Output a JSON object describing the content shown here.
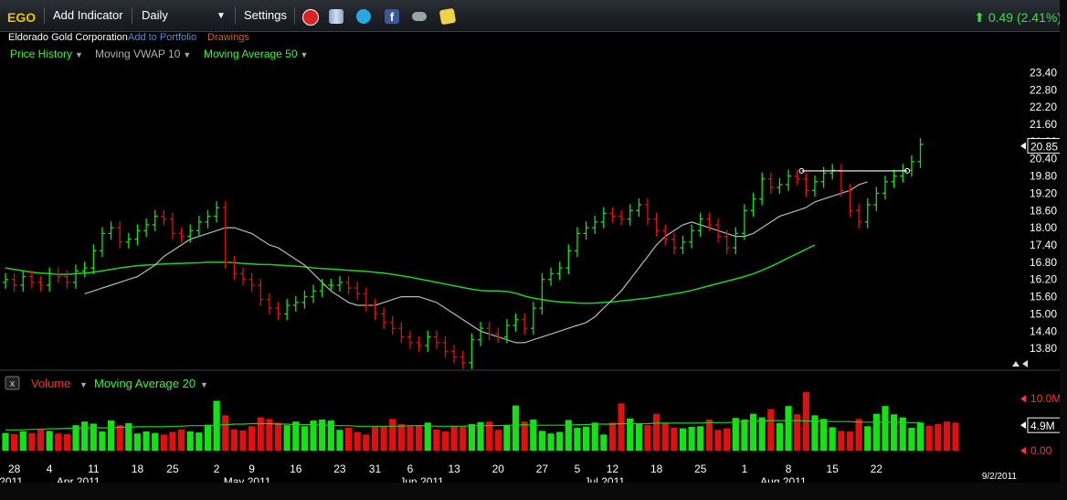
{
  "toolbar": {
    "ticker": "EGO",
    "add_indicator": "Add Indicator",
    "interval": "Daily",
    "settings": "Settings",
    "change": "0.49 (2.41%)",
    "icons": [
      "alarm-clock-icon",
      "books-icon",
      "twitter-icon",
      "facebook-icon",
      "binoculars-icon",
      "note-icon"
    ]
  },
  "header": {
    "company": "Eldorado Gold Corporation",
    "add_to_portfolio": "Add to Portfolio",
    "drawings": "Drawings"
  },
  "price_legend": {
    "price_history": "Price History",
    "vwap": "Moving VWAP 10",
    "ma": "Moving Average 50"
  },
  "volume_legend": {
    "volume": "Volume",
    "ma": "Moving Average 20"
  },
  "colors": {
    "up": "#16e016",
    "down": "#e01010",
    "ma": "#1fd21f",
    "vwap": "#b8b8b8",
    "ticker": "#f2c200"
  },
  "chart_data": {
    "type": "ohlc",
    "price_axis": {
      "ticks": [
        "23.40",
        "22.80",
        "22.20",
        "21.60",
        "21.00",
        "20.40",
        "19.80",
        "19.20",
        "18.60",
        "18.00",
        "17.40",
        "16.80",
        "16.20",
        "15.60",
        "15.00",
        "14.40",
        "13.80"
      ],
      "last_price": "20.85",
      "ylim": [
        13.2,
        23.7
      ]
    },
    "volume_axis": {
      "ticks": [
        "10.0M",
        "4.9M",
        "0.00"
      ]
    },
    "x_labels": [
      {
        "i": 1,
        "t": "28"
      },
      {
        "i": 5,
        "t": "4"
      },
      {
        "i": 10,
        "t": "11"
      },
      {
        "i": 15,
        "t": "18"
      },
      {
        "i": 19,
        "t": "25"
      },
      {
        "i": 24,
        "t": "2"
      },
      {
        "i": 28,
        "t": "9"
      },
      {
        "i": 33,
        "t": "16"
      },
      {
        "i": 38,
        "t": "23"
      },
      {
        "i": 42,
        "t": "31"
      },
      {
        "i": 46,
        "t": "6"
      },
      {
        "i": 51,
        "t": "13"
      },
      {
        "i": 56,
        "t": "20"
      },
      {
        "i": 61,
        "t": "27"
      },
      {
        "i": 65,
        "t": "5"
      },
      {
        "i": 69,
        "t": "12"
      },
      {
        "i": 74,
        "t": "18"
      },
      {
        "i": 79,
        "t": "25"
      },
      {
        "i": 84,
        "t": "1"
      },
      {
        "i": 89,
        "t": "8"
      },
      {
        "i": 94,
        "t": "15"
      },
      {
        "i": 99,
        "t": "22"
      }
    ],
    "month_labels": [
      "2011",
      "Apr 2011",
      "May 2011",
      "Jun 2011",
      "Jul 2011",
      "Aug 2011"
    ],
    "month_positions": [
      -0.5,
      6,
      25,
      45,
      66,
      86
    ],
    "end_date": "9/2/2011",
    "closes": [
      16.2,
      16.0,
      16.3,
      16.1,
      16.0,
      16.4,
      16.3,
      16.1,
      16.5,
      16.6,
      17.2,
      17.8,
      18.0,
      17.5,
      17.6,
      17.9,
      18.1,
      18.4,
      18.3,
      17.8,
      17.7,
      17.9,
      18.2,
      18.4,
      18.7,
      16.8,
      16.4,
      16.2,
      16.0,
      15.5,
      15.2,
      15.0,
      15.3,
      15.4,
      15.6,
      15.8,
      16.0,
      16.0,
      16.1,
      15.9,
      15.7,
      15.3,
      15.0,
      14.7,
      14.5,
      14.2,
      14.0,
      13.9,
      14.2,
      14.0,
      13.7,
      13.5,
      13.3,
      14.1,
      14.5,
      14.3,
      14.2,
      14.6,
      14.8,
      14.5,
      15.2,
      16.2,
      16.4,
      16.6,
      17.2,
      17.8,
      18.0,
      18.2,
      18.5,
      18.4,
      18.3,
      18.6,
      18.8,
      18.3,
      17.9,
      17.6,
      17.3,
      17.5,
      17.9,
      18.3,
      18.1,
      17.7,
      17.3,
      17.8,
      18.6,
      19.0,
      19.7,
      19.4,
      19.5,
      19.8,
      19.7,
      19.3,
      19.6,
      19.9,
      20.0,
      19.3,
      18.6,
      18.2,
      18.8,
      19.2,
      19.6,
      19.8,
      20.0,
      20.3,
      20.9
    ],
    "ma50": [
      16.6,
      16.55,
      16.5,
      16.45,
      16.42,
      16.4,
      16.38,
      16.38,
      16.4,
      16.42,
      16.45,
      16.5,
      16.55,
      16.6,
      16.64,
      16.68,
      16.7,
      16.72,
      16.74,
      16.75,
      16.76,
      16.77,
      16.78,
      16.8,
      16.8,
      16.8,
      16.78,
      16.76,
      16.74,
      16.72,
      16.72,
      16.7,
      16.68,
      16.66,
      16.64,
      16.6,
      16.58,
      16.56,
      16.54,
      16.52,
      16.5,
      16.48,
      16.45,
      16.42,
      16.38,
      16.33,
      16.28,
      16.22,
      16.16,
      16.1,
      16.04,
      15.98,
      15.92,
      15.86,
      15.82,
      15.8,
      15.8,
      15.78,
      15.72,
      15.62,
      15.55,
      15.5,
      15.45,
      15.42,
      15.4,
      15.38,
      15.37,
      15.38,
      15.4,
      15.42,
      15.45,
      15.48,
      15.52,
      15.55,
      15.6,
      15.65,
      15.7,
      15.75,
      15.82,
      15.9,
      15.98,
      16.06,
      16.14,
      16.22,
      16.3,
      16.4,
      16.52,
      16.65,
      16.8,
      16.95,
      17.1,
      17.25,
      17.4
    ],
    "vwap": [
      15.7,
      15.8,
      15.9,
      16.0,
      16.1,
      16.2,
      16.3,
      16.5,
      16.7,
      17.0,
      17.2,
      17.4,
      17.6,
      17.7,
      17.8,
      17.9,
      18.0,
      18.0,
      17.9,
      17.8,
      17.6,
      17.4,
      17.3,
      17.1,
      16.9,
      16.7,
      16.4,
      16.1,
      15.8,
      15.6,
      15.4,
      15.3,
      15.3,
      15.3,
      15.4,
      15.5,
      15.6,
      15.6,
      15.6,
      15.5,
      15.4,
      15.2,
      15.0,
      14.8,
      14.6,
      14.4,
      14.3,
      14.2,
      14.1,
      14.0,
      14.0,
      14.1,
      14.2,
      14.3,
      14.4,
      14.5,
      14.6,
      14.7,
      14.9,
      15.2,
      15.5,
      15.8,
      16.2,
      16.6,
      17.0,
      17.4,
      17.7,
      17.9,
      18.1,
      18.2,
      18.1,
      18.0,
      17.9,
      17.8,
      17.7,
      17.7,
      17.8,
      18.0,
      18.2,
      18.4,
      18.5,
      18.6,
      18.7,
      18.9,
      19.0,
      19.1,
      19.2,
      19.3,
      19.5,
      19.6
    ],
    "vwap_start": 9,
    "resistance_line": {
      "x1": 90.5,
      "x2": 102.5,
      "y": 19.98
    },
    "volume": [
      3.4,
      3.2,
      3.7,
      3.4,
      4.0,
      3.8,
      3.3,
      3.2,
      4.9,
      5.6,
      5.2,
      3.7,
      5.8,
      4.9,
      5.3,
      3.3,
      3.7,
      3.4,
      3.1,
      3.6,
      4.1,
      3.7,
      3.5,
      5.0,
      9.6,
      6.8,
      4.1,
      3.9,
      4.7,
      6.4,
      6.1,
      5.4,
      4.9,
      5.6,
      4.7,
      5.8,
      6.0,
      5.8,
      4.0,
      4.4,
      3.6,
      3.1,
      4.6,
      4.7,
      6.1,
      5.1,
      4.7,
      4.9,
      5.4,
      4.1,
      3.7,
      4.8,
      4.6,
      5.1,
      5.5,
      5.6,
      4.0,
      4.9,
      8.7,
      5.6,
      6.0,
      3.8,
      3.3,
      3.6,
      5.9,
      4.4,
      4.6,
      5.4,
      3.1,
      5.4,
      9.1,
      6.2,
      5.2,
      4.9,
      7.1,
      5.3,
      4.4,
      4.3,
      4.6,
      4.7,
      6.0,
      4.0,
      4.3,
      6.3,
      6.0,
      7.1,
      6.4,
      8.0,
      5.3,
      8.6,
      7.0,
      11.3,
      6.8,
      6.1,
      4.5,
      3.8,
      3.7,
      6.1,
      4.7,
      7.1,
      8.6,
      7.0,
      6.4,
      4.4,
      5.4,
      4.8,
      5.1,
      5.6,
      5.4
    ],
    "vol_ma20": [
      4.0,
      4.0,
      4.0,
      4.1,
      4.1,
      4.2,
      4.2,
      4.3,
      4.3,
      4.4,
      4.4,
      4.4,
      4.4,
      4.5,
      4.5,
      4.6,
      4.6,
      4.6,
      4.6,
      4.7,
      4.7,
      4.8,
      4.8,
      4.8,
      4.9,
      5.0,
      5.1,
      5.1,
      5.2,
      5.2,
      5.2,
      5.1,
      5.1,
      5.0,
      5.0,
      5.0,
      4.9,
      4.9,
      4.8,
      4.8,
      4.7,
      4.7,
      4.7,
      4.7,
      4.7,
      4.7,
      4.8,
      4.8,
      4.8,
      4.7,
      4.7,
      4.7,
      4.7,
      4.8,
      4.8,
      4.8,
      4.8,
      4.9,
      4.9,
      5.0,
      4.9,
      4.9,
      4.9,
      4.9,
      4.9,
      5.0,
      5.0,
      5.1,
      5.1,
      5.1,
      5.2,
      5.2,
      5.2,
      5.2,
      5.3,
      5.3,
      5.3,
      5.3,
      5.3,
      5.3,
      5.4,
      5.4,
      5.4,
      5.5,
      5.6,
      5.7,
      5.7,
      5.8,
      5.8,
      5.8,
      5.8,
      5.7,
      5.7,
      5.7,
      5.6,
      5.6,
      5.6,
      5.5,
      5.5,
      5.5,
      5.5,
      5.5,
      5.4,
      5.4,
      5.4
    ]
  }
}
